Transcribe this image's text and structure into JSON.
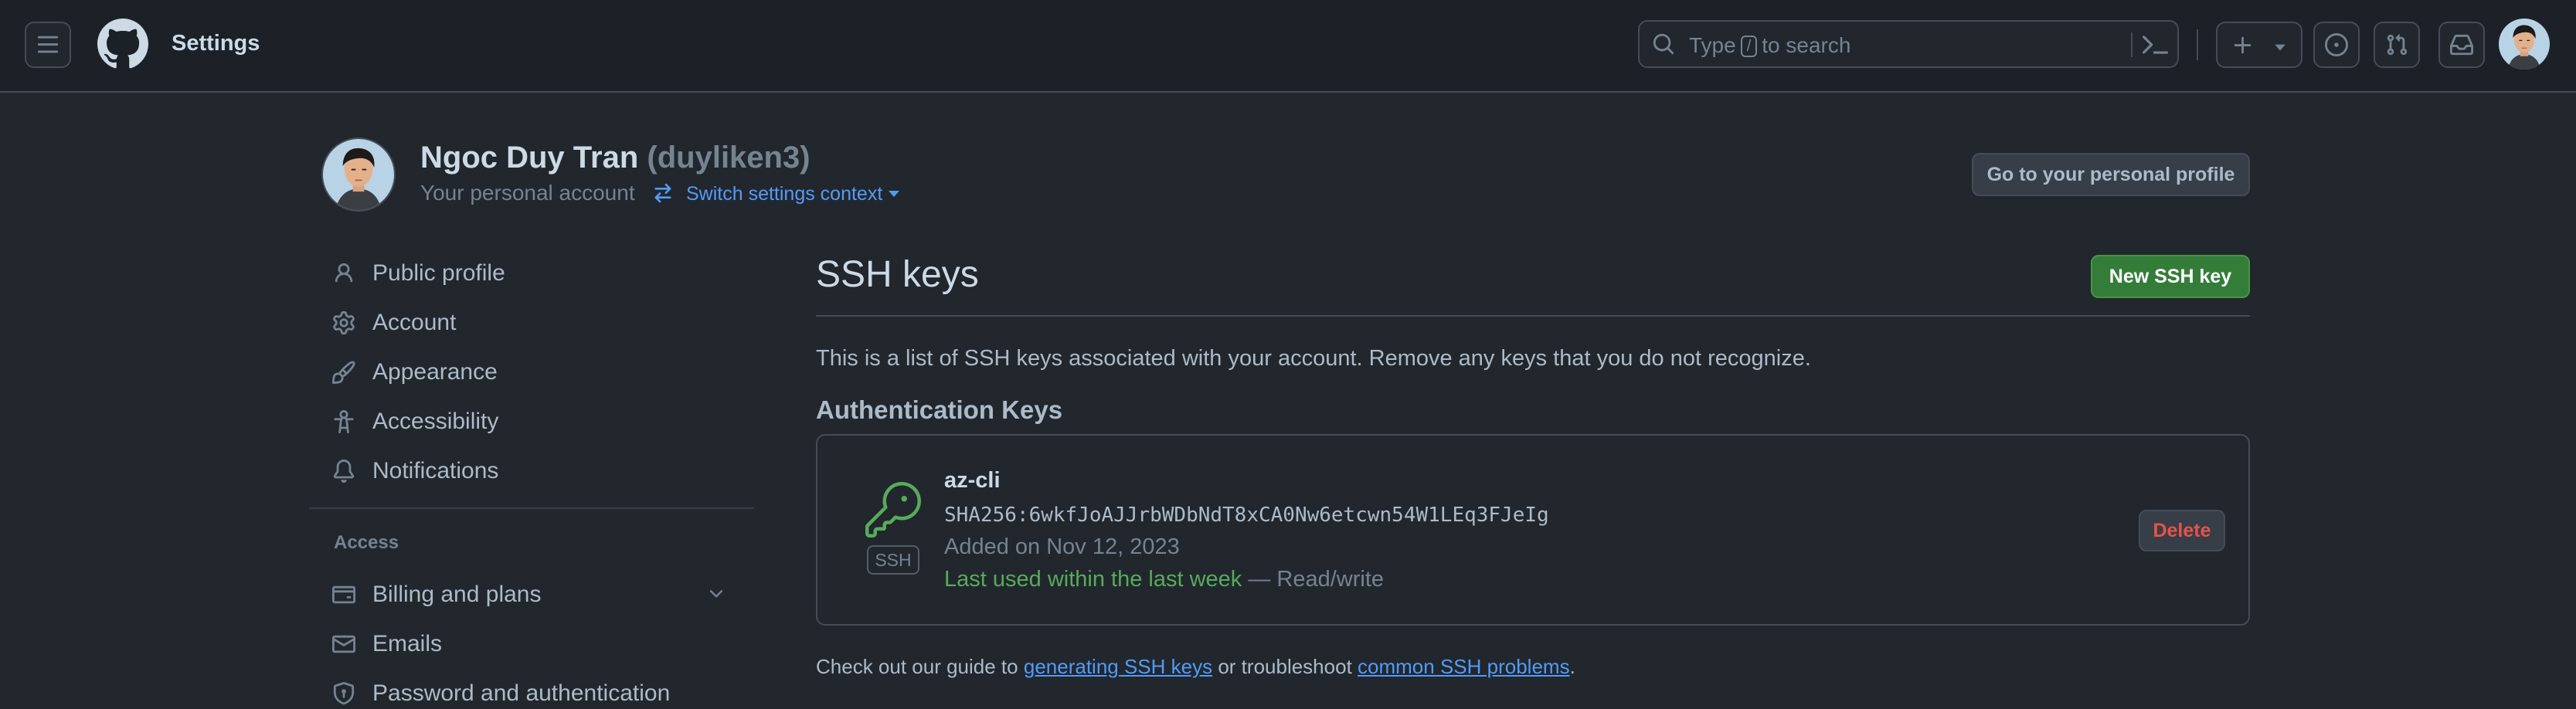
{
  "header": {
    "title": "Settings",
    "search": {
      "type_label": "Type",
      "key": "/",
      "suffix": "to search"
    }
  },
  "account": {
    "name": "Ngoc Duy Tran",
    "login": "(duyliken3)",
    "subtitle": "Your personal account",
    "switch_label": "Switch settings context",
    "go_profile_label": "Go to your personal profile"
  },
  "sidebar": {
    "items": [
      {
        "label": "Public profile",
        "icon": "person-icon"
      },
      {
        "label": "Account",
        "icon": "gear-icon"
      },
      {
        "label": "Appearance",
        "icon": "paintbrush-icon"
      },
      {
        "label": "Accessibility",
        "icon": "accessibility-icon"
      },
      {
        "label": "Notifications",
        "icon": "bell-icon"
      }
    ],
    "access_heading": "Access",
    "access_items": [
      {
        "label": "Billing and plans",
        "icon": "credit-card-icon"
      },
      {
        "label": "Emails",
        "icon": "mail-icon"
      },
      {
        "label": "Password and authentication",
        "icon": "shield-lock-icon"
      }
    ]
  },
  "main": {
    "title": "SSH keys",
    "new_key_label": "New SSH key",
    "intro": "This is a list of SSH keys associated with your account. Remove any keys that you do not recognize.",
    "section_title": "Authentication Keys",
    "keys": [
      {
        "title": "az-cli",
        "fingerprint": "SHA256:6wkfJoAJJrbWDbNdT8xCA0Nw6etcwn54W1LEq3FJeIg",
        "added": "Added on Nov 12, 2023",
        "last_used": "Last used within the last week",
        "access": "— Read/write",
        "badge": "SSH",
        "delete_label": "Delete"
      }
    ],
    "footer": {
      "prefix": "Check out our guide to",
      "link1": "generating SSH keys",
      "middle": "or troubleshoot",
      "link2": "common SSH problems",
      "suffix": "."
    }
  },
  "colors": {
    "background": "#22272e",
    "header": "#1c2128",
    "accent_link": "#539bf5",
    "success": "#347d39",
    "danger": "#e5534b"
  }
}
